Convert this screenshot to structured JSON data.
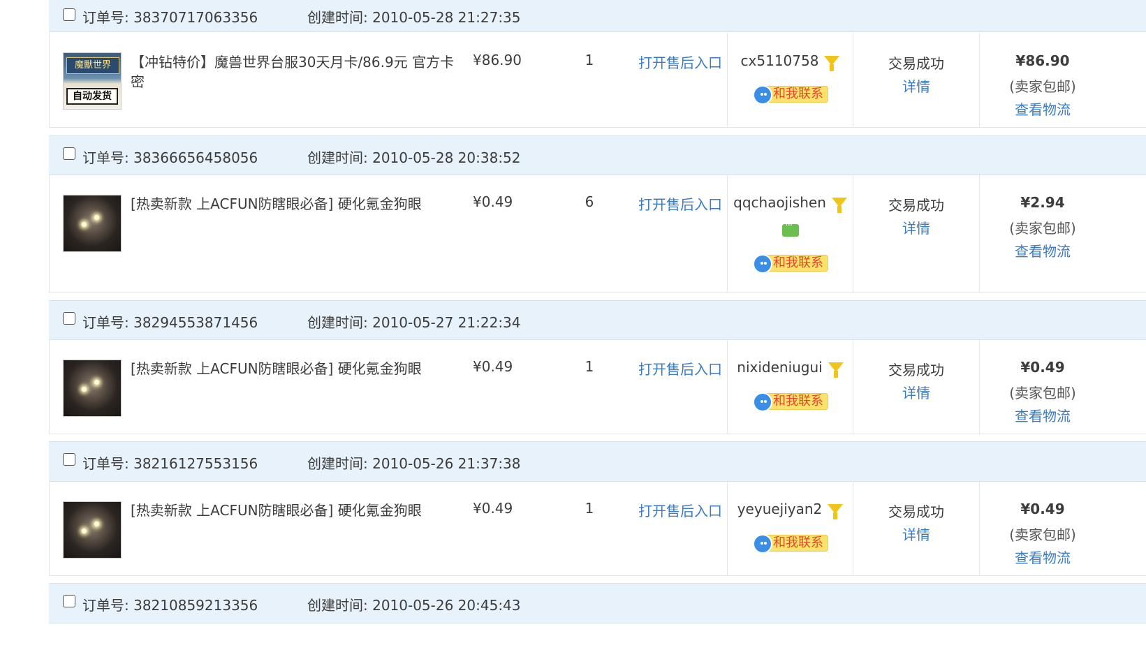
{
  "labels": {
    "order_no_prefix": "订单号: ",
    "created_prefix": "创建时间: ",
    "after_sales": "打开售后入口",
    "contact": "和我联系",
    "detail": "详情",
    "free_shipping": "(卖家包邮)",
    "track": "查看物流"
  },
  "orders": [
    {
      "order_no": "订单号: 38370717063356",
      "created": "创建时间: 2010-05-28 21:27:35",
      "thumb_icon": "wow-game-card-thumbnail",
      "thumb_text_1": "魔獸世界",
      "thumb_text_2": "自动发货",
      "title": "【冲钻特价】魔兽世界台服30天月卡/86.9元 官方卡密",
      "price": "¥86.90",
      "qty": "1",
      "seller": "cx5110758",
      "status": "交易成功",
      "total": "¥86.90"
    },
    {
      "order_no": "订单号: 38366656458056",
      "created": "创建时间: 2010-05-28 20:38:52",
      "thumb_icon": "dog-photo-thumbnail",
      "title": "[热卖新款 上ACFUN防瞎眼必备] 硬化氪金狗眼",
      "price": "¥0.49",
      "qty": "6",
      "seller": "qqchaojishen",
      "status": "交易成功",
      "total": "¥2.94"
    },
    {
      "order_no": "订单号: 38294553871456",
      "created": "创建时间: 2010-05-27 21:22:34",
      "thumb_icon": "dog-photo-thumbnail",
      "title": "[热卖新款 上ACFUN防瞎眼必备] 硬化氪金狗眼",
      "price": "¥0.49",
      "qty": "1",
      "seller": "nixideniugui",
      "status": "交易成功",
      "total": "¥0.49"
    },
    {
      "order_no": "订单号: 38216127553156",
      "created": "创建时间: 2010-05-26 21:37:38",
      "thumb_icon": "dog-photo-thumbnail",
      "title": "[热卖新款 上ACFUN防瞎眼必备] 硬化氪金狗眼",
      "price": "¥0.49",
      "qty": "1",
      "seller": "yeyuejiyan2",
      "status": "交易成功",
      "total": "¥0.49"
    },
    {
      "order_no": "订单号: 38210859213356",
      "created": "创建时间: 2010-05-26 20:45:43"
    }
  ],
  "colors": {
    "header_bg": "#e8f2fb",
    "link": "#3b7cc4",
    "contact_btn": "#fbe26a",
    "funnel": "#f0c419",
    "wangwang_msg": "#6bbf4e"
  }
}
